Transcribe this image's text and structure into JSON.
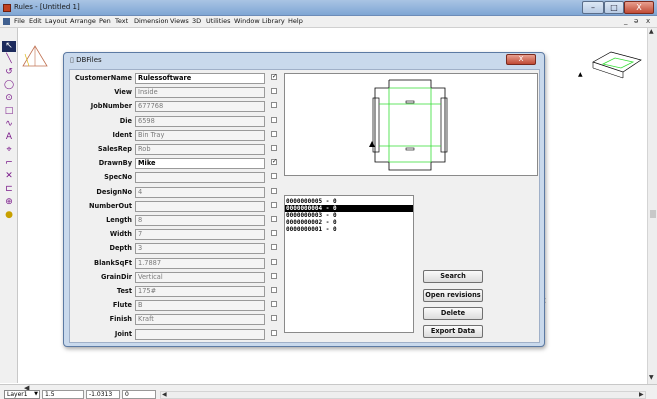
{
  "window": {
    "title": "Rules - [Untitled 1]",
    "controls": {
      "minimize": "–",
      "maximize": "□",
      "close": "X"
    }
  },
  "menu": {
    "items": [
      "File",
      "Edit",
      "Layout",
      "Arrange",
      "Pen",
      "Text",
      "Dimension",
      "Views",
      "3D",
      "Utilities",
      "Window",
      "Library",
      "Help"
    ],
    "mdi_controls": {
      "minimize": "_",
      "restore": "ə",
      "close": "x"
    }
  },
  "toolbox": {
    "tools": [
      {
        "icon": "pointer-icon",
        "glyph": "↖"
      },
      {
        "icon": "line-icon",
        "glyph": "╲"
      },
      {
        "icon": "arc-icon",
        "glyph": "↺"
      },
      {
        "icon": "circle-icon",
        "glyph": "◯"
      },
      {
        "icon": "ellipse-icon",
        "glyph": "⊙"
      },
      {
        "icon": "rectangle-icon",
        "glyph": "□"
      },
      {
        "icon": "curve-icon",
        "glyph": "∿"
      },
      {
        "icon": "text-icon",
        "glyph": "A"
      },
      {
        "icon": "dimension-icon",
        "glyph": "⌖"
      },
      {
        "icon": "fillet-icon",
        "glyph": "⌐"
      },
      {
        "icon": "trim-icon",
        "glyph": "✕"
      },
      {
        "icon": "offset-icon",
        "glyph": "⊏"
      },
      {
        "icon": "zoom-icon",
        "glyph": "⊕"
      },
      {
        "icon": "library-icon",
        "glyph": "●"
      }
    ]
  },
  "status": {
    "layer": "Layer1",
    "scale": "1.5",
    "coord_x": "-1.0313",
    "coord_y": "0"
  },
  "dialog": {
    "title": "DBFiles",
    "close": "X",
    "fields": [
      {
        "label": "CustomerName",
        "value": "Rulessoftware",
        "checked": true
      },
      {
        "label": "View",
        "value": "Inside",
        "checked": false
      },
      {
        "label": "JobNumber",
        "value": "677768",
        "checked": false
      },
      {
        "label": "Die",
        "value": "6598",
        "checked": false
      },
      {
        "label": "Ident",
        "value": "Bin Tray",
        "checked": false
      },
      {
        "label": "SalesRep",
        "value": "Rob",
        "checked": false
      },
      {
        "label": "DrawnBy",
        "value": "Mike",
        "checked": true
      },
      {
        "label": "SpecNo",
        "value": "",
        "checked": false
      },
      {
        "label": "DesignNo",
        "value": "4",
        "checked": false
      },
      {
        "label": "NumberOut",
        "value": "",
        "checked": false
      },
      {
        "label": "Length",
        "value": "8",
        "checked": false
      },
      {
        "label": "Width",
        "value": "7",
        "checked": false
      },
      {
        "label": "Depth",
        "value": "3",
        "checked": false
      },
      {
        "label": "BlankSqFt",
        "value": "1.7887",
        "checked": false
      },
      {
        "label": "GrainDir",
        "value": "Vertical",
        "checked": false
      },
      {
        "label": "Test",
        "value": "175#",
        "checked": false
      },
      {
        "label": "Flute",
        "value": "B",
        "checked": false
      },
      {
        "label": "Finish",
        "value": "Kraft",
        "checked": false
      },
      {
        "label": "Joint",
        "value": "",
        "checked": false
      }
    ],
    "results": [
      {
        "text": "0000000005 - 0",
        "selected": false
      },
      {
        "text": "0000000004 - 0",
        "selected": true
      },
      {
        "text": "0000000003 - 0",
        "selected": false
      },
      {
        "text": "0000000002 - 0",
        "selected": false
      },
      {
        "text": "0000000001 - 0",
        "selected": false
      }
    ],
    "buttons": {
      "search": "Search",
      "open_revisions": "Open revisions",
      "delete": "Delete",
      "export": "Export Data"
    }
  },
  "colors": {
    "crease_green": "#33dd33",
    "outline_black": "#000000",
    "selection_bg": "#000000",
    "tool_purple": "#7a1a8a"
  }
}
